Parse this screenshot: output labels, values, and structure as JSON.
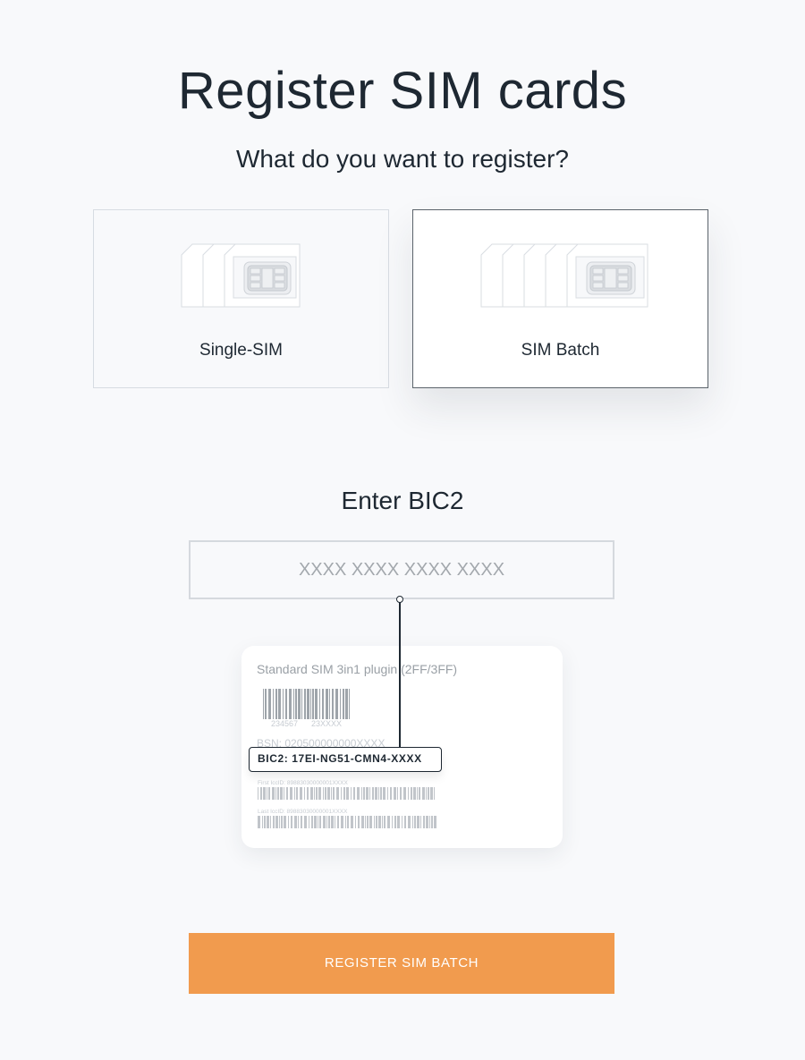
{
  "page": {
    "title": "Register SIM cards"
  },
  "type_selector": {
    "question": "What do you want to register?",
    "options": [
      {
        "label": "Single-SIM",
        "icon": "single-sim-icon",
        "selected": false
      },
      {
        "label": "SIM Batch",
        "icon": "sim-batch-icon",
        "selected": true
      }
    ]
  },
  "bic_entry": {
    "heading": "Enter BIC2",
    "placeholder": "XXXX XXXX XXXX XXXX",
    "value": ""
  },
  "sim_pack_illustration": {
    "title": "Standard SIM 3in1 plugin (2FF/3FF)",
    "barcode_numbers": [
      "234567",
      "23XXXX"
    ],
    "bsn": "BSN: 020500000000XXXX",
    "bic_callout": "BIC2: 17EI-NG51-CMN4-XXXX",
    "first_iccid": "First IccID: 89883030000001XXXX",
    "last_iccid": "Last IccID: 89883030000001XXXX"
  },
  "actions": {
    "register_label": "REGISTER SIM BATCH"
  },
  "colors": {
    "background": "#f8f9fb",
    "text": "#1e2832",
    "accent": "#f19b4e",
    "selected_border": "#5b636b",
    "muted_border": "#d7dce2"
  }
}
